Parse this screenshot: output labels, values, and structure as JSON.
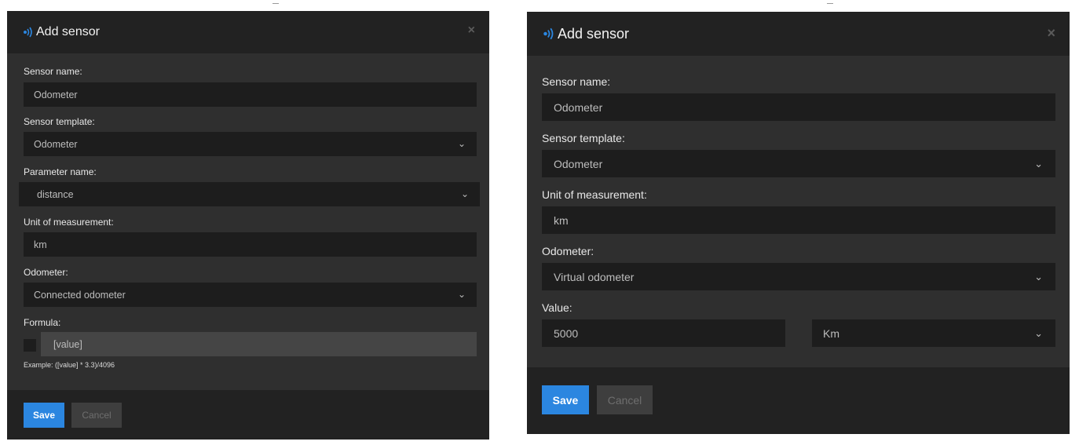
{
  "colors": {
    "accent": "#2b86e0",
    "dialog_bg": "#2f2f2f",
    "header_bg": "#222222",
    "field_bg": "#1d1d1d"
  },
  "left_dialog": {
    "title": "Add sensor",
    "title_icon": "signal-icon",
    "close": "×",
    "fields": {
      "sensor_name": {
        "label": "Sensor name:",
        "value": "Odometer"
      },
      "sensor_template": {
        "label": "Sensor template:",
        "value": "Odometer"
      },
      "parameter_name": {
        "label": "Parameter name:",
        "value": "distance"
      },
      "unit": {
        "label": "Unit of measurement:",
        "value": "km"
      },
      "odometer": {
        "label": "Odometer:",
        "value": "Connected odometer"
      },
      "formula": {
        "label": "Formula:",
        "value": "[value]",
        "example": "Example: ([value] * 3.3)/4096"
      }
    },
    "buttons": {
      "save": "Save",
      "cancel": "Cancel"
    }
  },
  "right_dialog": {
    "title": "Add sensor",
    "title_icon": "signal-icon",
    "close": "×",
    "fields": {
      "sensor_name": {
        "label": "Sensor name:",
        "value": "Odometer"
      },
      "sensor_template": {
        "label": "Sensor template:",
        "value": "Odometer"
      },
      "unit": {
        "label": "Unit of measurement:",
        "value": "km"
      },
      "odometer": {
        "label": "Odometer:",
        "value": "Virtual odometer"
      },
      "value": {
        "label": "Value:",
        "value": "5000",
        "unit": "Km"
      }
    },
    "buttons": {
      "save": "Save",
      "cancel": "Cancel"
    }
  }
}
